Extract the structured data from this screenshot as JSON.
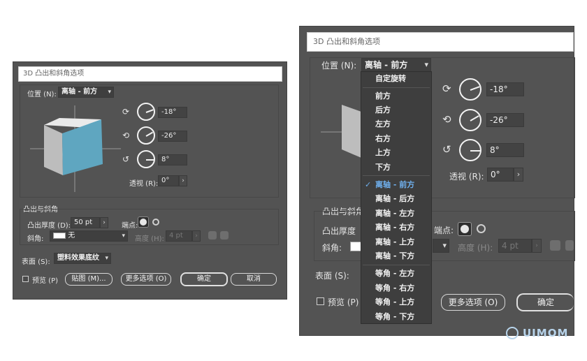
{
  "left": {
    "title": "3D 凸出和斜角选项",
    "position_label": "位置 (N):",
    "position_value": "离轴 - 前方",
    "rot_x": "-18°",
    "rot_y": "-26°",
    "rot_z": "8°",
    "perspective_label": "透视 (R):",
    "perspective_value": "0°",
    "extrude_group_label": "凸出与斜角",
    "extrude_depth_label": "凸出厚度 (D):",
    "extrude_depth_value": "50 pt",
    "cap_label": "端点:",
    "bevel_label": "斜角:",
    "bevel_value": "无",
    "height_label": "高度 (H):",
    "height_value": "4 pt",
    "surface_label": "表面 (S):",
    "surface_value": "塑料效果底纹",
    "preview_label": "预览 (P)",
    "map_button": "贴图 (M)...",
    "more_button": "更多选项 (O)",
    "ok_button": "确定",
    "cancel_button": "取消"
  },
  "right": {
    "title": "3D 凸出和斜角选项",
    "position_label": "位置 (N):",
    "position_value": "离轴 - 前方",
    "rot_x": "-18°",
    "rot_y": "-26°",
    "rot_z": "8°",
    "perspective_label": "透视 (R):",
    "perspective_value": "0°",
    "extrude_group_label": "凸出与斜角",
    "extrude_depth_label": "凸出厚度",
    "cap_label": "端点:",
    "bevel_label": "斜角:",
    "height_label": "高度 (H):",
    "height_value": "4 pt",
    "surface_label": "表面 (S):",
    "preview_label": "预览 (P)",
    "more_button": "更多选项 (O)",
    "ok_button": "确定",
    "menu_items": [
      "自定旋转",
      "前方",
      "后方",
      "左方",
      "右方",
      "上方",
      "下方",
      "离轴 - 前方",
      "离轴 - 后方",
      "离轴 - 左方",
      "离轴 - 右方",
      "离轴 - 上方",
      "离轴 - 下方",
      "等角 - 左方",
      "等角 - 右方",
      "等角 - 上方",
      "等角 - 下方"
    ],
    "selected_item": "离轴 - 前方"
  },
  "watermark": "UIMOM",
  "colors": {
    "panel": "#535353",
    "cube_front": "#5fa6c0",
    "selected": "#6fb0ee"
  }
}
